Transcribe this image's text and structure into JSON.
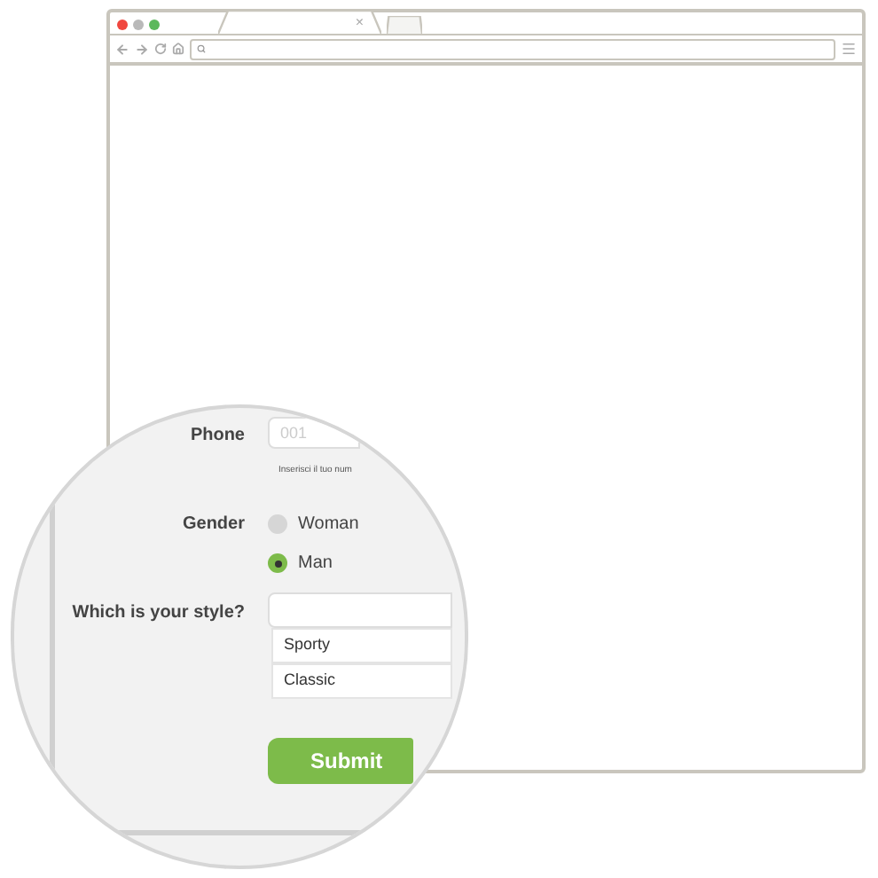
{
  "browser": {
    "tabs": [
      {
        "selected": true,
        "close_glyph": "×"
      },
      {
        "selected": false
      }
    ]
  },
  "form": {
    "phone": {
      "label": "Phone",
      "placeholder": "001",
      "hint": "Inserisci il tuo num"
    },
    "gender": {
      "label": "Gender",
      "options": [
        {
          "label": "Woman",
          "selected": false
        },
        {
          "label": "Man",
          "selected": true
        }
      ]
    },
    "style": {
      "label": "Which is your style?",
      "options": [
        "Sporty",
        "Classic"
      ]
    },
    "submit": "Submit"
  }
}
